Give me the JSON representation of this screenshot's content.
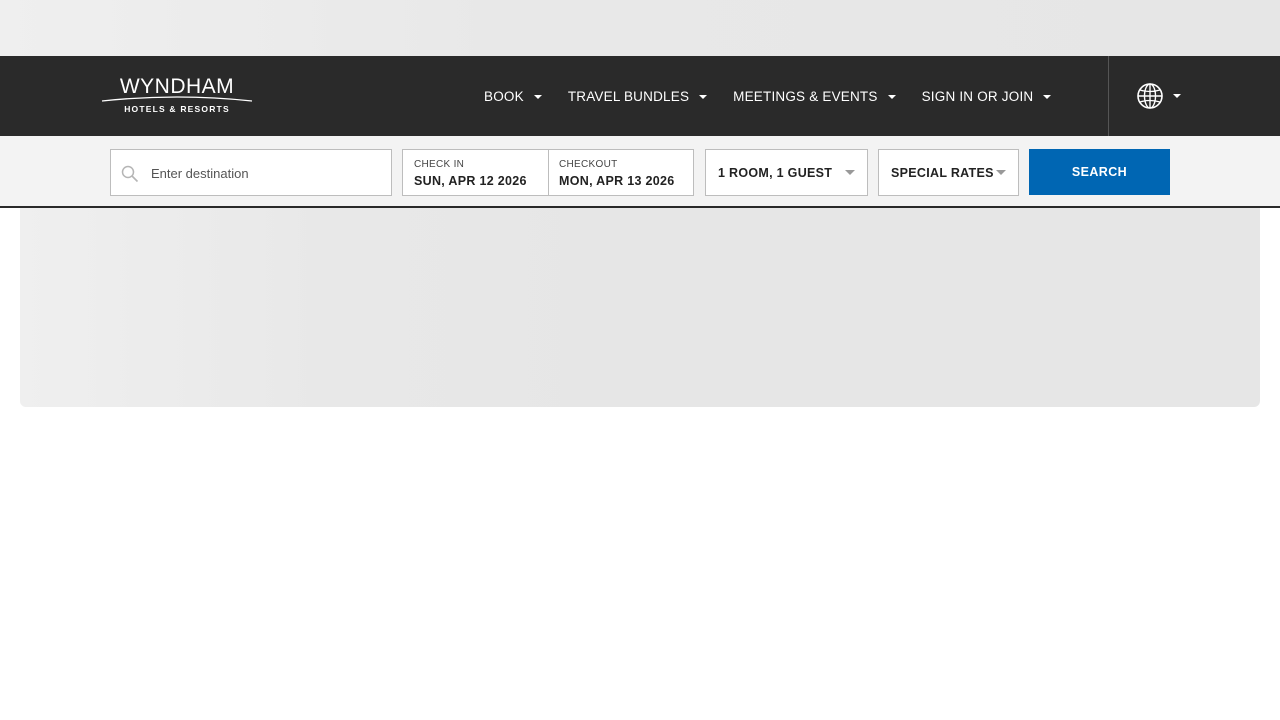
{
  "brand": {
    "name": "WYNDHAM",
    "subtitle": "HOTELS & RESORTS"
  },
  "nav": {
    "items": [
      {
        "label": "BOOK"
      },
      {
        "label": "TRAVEL BUNDLES"
      },
      {
        "label": "MEETINGS & EVENTS"
      },
      {
        "label": "SIGN IN OR JOIN"
      }
    ],
    "language_icon": "globe-icon"
  },
  "search": {
    "destination_placeholder": "Enter destination",
    "destination_value": "",
    "check_in_label": "CHECK IN",
    "check_in_value": "SUN, APR 12 2026",
    "checkout_label": "CHECKOUT",
    "checkout_value": "MON, APR 13 2026",
    "rooms_guests": "1 ROOM, 1 GUEST",
    "special_rates": "SPECIAL RATES",
    "button_label": "SEARCH"
  },
  "colors": {
    "navbar_bg": "#2a2a2a",
    "search_button": "#0066b3",
    "search_bar_bg": "#f3f3f3",
    "placeholder_bg": "#e6e6e6"
  }
}
